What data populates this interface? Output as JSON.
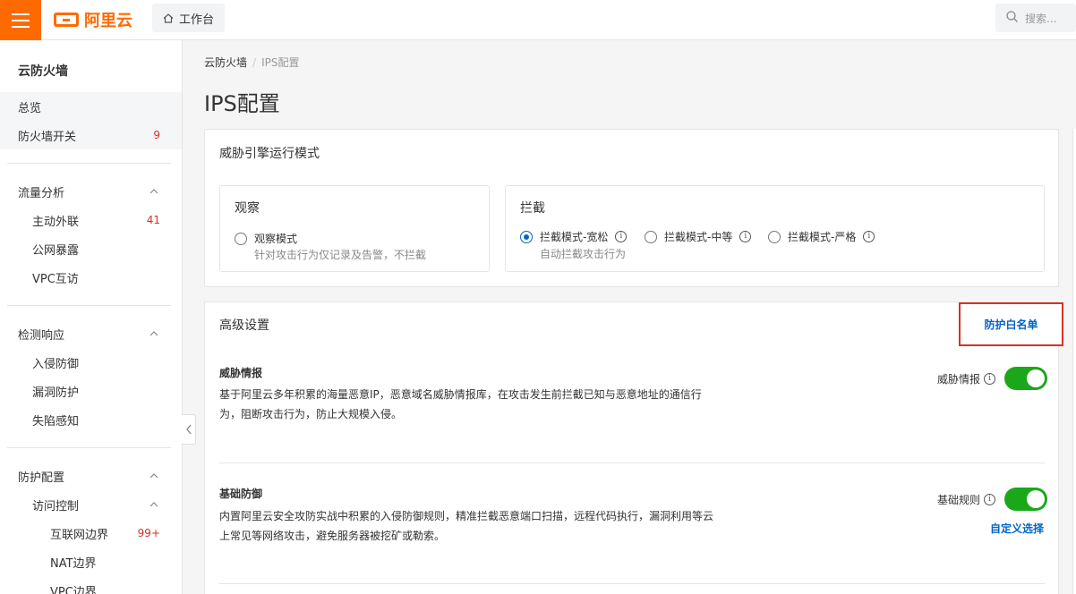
{
  "topbar": {
    "brand": "阿里云",
    "workbench": "工作台",
    "search_placeholder": "搜索..."
  },
  "sidebar": {
    "title": "云防火墙",
    "items": [
      {
        "label": "总览"
      },
      {
        "label": "防火墙开关",
        "badge": "9"
      },
      {
        "label": "流量分析"
      },
      {
        "label": "主动外联",
        "badge": "41"
      },
      {
        "label": "公网暴露"
      },
      {
        "label": "VPC互访"
      },
      {
        "label": "检测响应"
      },
      {
        "label": "入侵防御"
      },
      {
        "label": "漏洞防护"
      },
      {
        "label": "失陷感知"
      },
      {
        "label": "防护配置"
      },
      {
        "label": "访问控制"
      },
      {
        "label": "互联网边界",
        "badge": "99+"
      },
      {
        "label": "NAT边界"
      },
      {
        "label": "VPC边界"
      }
    ]
  },
  "breadcrumb": {
    "parent": "云防火墙",
    "separator": "/",
    "current": "IPS配置"
  },
  "page_title": "IPS配置",
  "engine": {
    "title": "威胁引擎运行模式",
    "observe": {
      "title": "观察",
      "option": "观察模式",
      "desc": "针对攻击行为仅记录及告警，不拦截"
    },
    "block": {
      "title": "拦截",
      "options": [
        "拦截模式-宽松",
        "拦截模式-中等",
        "拦截模式-严格"
      ],
      "selected": "拦截模式-宽松",
      "desc": "自动拦截攻击行为"
    }
  },
  "advanced": {
    "title": "高级设置",
    "whitelist_link": "防护白名单",
    "threat_intel": {
      "title": "威胁情报",
      "desc": "基于阿里云多年积累的海量恶意IP，恶意域名威胁情报库，在攻击发生前拦截已知与恶意地址的通信行为，阻断攻击行为，防止大规模入侵。",
      "switch_label": "威胁情报",
      "enabled": true
    },
    "basic_defense": {
      "title": "基础防御",
      "desc": "内置阿里云安全攻防实战中积累的入侵防御规则，精准拦截恶意端口扫描，远程代码执行，漏洞利用等云上常见等网络攻击，避免服务器被挖矿或勒索。",
      "switch_label": "基础规则",
      "enabled": true,
      "custom_link": "自定义选择"
    }
  },
  "colors": {
    "brand": "#ff6a00",
    "link": "#0064c8",
    "toggle_on": "#1aa81a",
    "badge": "#d93026"
  }
}
